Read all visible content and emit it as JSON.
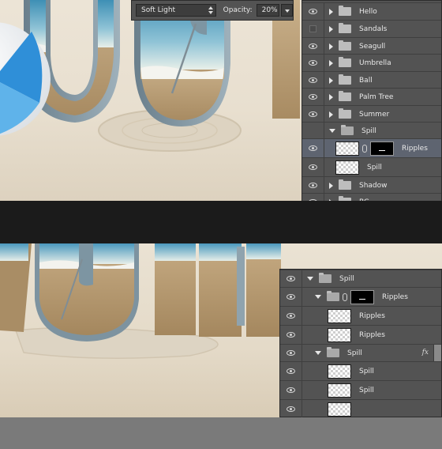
{
  "options_bar": {
    "blend_mode": "Soft Light",
    "opacity_label": "Opacity:",
    "opacity_value": "20%"
  },
  "layers_top": {
    "rows": [
      {
        "name": "Hello",
        "visible": true,
        "type": "group-closed"
      },
      {
        "name": "Sandals",
        "visible": false,
        "type": "group-closed"
      },
      {
        "name": "Seagull",
        "visible": true,
        "type": "group-closed"
      },
      {
        "name": "Umbrella",
        "visible": true,
        "type": "group-closed"
      },
      {
        "name": "Ball",
        "visible": true,
        "type": "group-closed"
      },
      {
        "name": "Palm Tree",
        "visible": true,
        "type": "group-closed"
      },
      {
        "name": "Summer",
        "visible": true,
        "type": "group-closed"
      },
      {
        "name": "Spill",
        "visible": false,
        "type": "group-open"
      },
      {
        "name": "Ripples",
        "visible": true,
        "type": "layer-mask",
        "selected": true
      },
      {
        "name": "Spill",
        "visible": true,
        "type": "layer"
      },
      {
        "name": "Shadow",
        "visible": true,
        "type": "group-closed"
      },
      {
        "name": "BG",
        "visible": true,
        "type": "group-closed"
      }
    ]
  },
  "layers_bottom": {
    "rows": [
      {
        "name": "Spill",
        "visible": true,
        "type": "group-open"
      },
      {
        "name": "Ripples",
        "visible": true,
        "type": "group-open-mask"
      },
      {
        "name": "Ripples",
        "visible": true,
        "type": "layer"
      },
      {
        "name": "Ripples",
        "visible": true,
        "type": "layer"
      },
      {
        "name": "Spill",
        "visible": true,
        "type": "group-open-fx",
        "fx": "fx"
      },
      {
        "name": "Spill",
        "visible": true,
        "type": "layer"
      },
      {
        "name": "Spill",
        "visible": true,
        "type": "layer"
      },
      {
        "name": "",
        "visible": true,
        "type": "layer"
      }
    ]
  },
  "colors": {
    "panel_bg": "#535353",
    "panel_border": "#2c2c2c",
    "selected_row": "#5e6470",
    "text": "#e8e8e8",
    "separator_dark": "#1b1b1b",
    "canvas_gray": "#7a7a7a"
  }
}
